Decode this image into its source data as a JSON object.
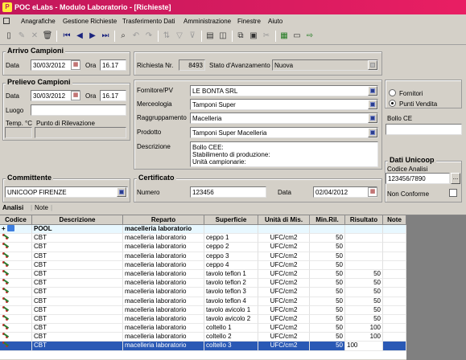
{
  "window": {
    "title": "POC eLabs - Modulo Laboratorio - [Richieste]",
    "logo": "P"
  },
  "menu": {
    "items": [
      "Anagrafiche",
      "Gestione Richieste",
      "Trasferimento Dati",
      "Amministrazione",
      "Finestre",
      "Aiuto"
    ]
  },
  "arrivo": {
    "title": "Arrivo Campioni",
    "data_label": "Data",
    "data_value": "30/03/2012",
    "ora_label": "Ora",
    "ora_value": "16.17"
  },
  "richiesta": {
    "nr_label": "Richiesta Nr.",
    "nr_value": "8493",
    "stato_label": "Stato d'Avanzamento",
    "stato_value": "Nuova"
  },
  "prelievo": {
    "title": "Prelievo Campioni",
    "data_label": "Data",
    "data_value": "30/03/2012",
    "ora_label": "Ora",
    "ora_value": "16.17",
    "luogo_label": "Luogo",
    "luogo_value": "",
    "temp_label": "Temp. °C",
    "punto_label": "Punto di Rilevazione"
  },
  "fornitore": {
    "label": "Fornitore/PV",
    "value": "LE BONTA  SRL"
  },
  "merceologia": {
    "label": "Merceologia",
    "value": "Tamponi Super"
  },
  "raggruppamento": {
    "label": "Raggruppamento",
    "value": "Macelleria"
  },
  "prodotto": {
    "label": "Prodotto",
    "value": "Tamponi Super Macelleria"
  },
  "descrizione": {
    "label": "Descrizione",
    "lines": [
      "Bollo CEE:",
      "Stabilimento di produzione:",
      "Unità campionarie:"
    ]
  },
  "radio": {
    "fornitori": "Fornitori",
    "punti_vendita": "Punti Vendita"
  },
  "bollo": {
    "label": "Bollo CE",
    "value": ""
  },
  "committente": {
    "title": "Committente",
    "value": "UNICOOP FIRENZE"
  },
  "certificato": {
    "title": "Certificato",
    "numero_label": "Numero",
    "numero_value": "123456",
    "data_label": "Data",
    "data_value": "02/04/2012"
  },
  "unicoop": {
    "title": "Dati Unicoop",
    "codice_label": "Codice Analisi",
    "codice_value": "123456/7890",
    "btn": "...",
    "nonconf_label": "Non Conforme"
  },
  "tabs": {
    "analisi": "Analisi",
    "note": "Note"
  },
  "grid": {
    "headers": [
      "Codice",
      "Descrizione",
      "Reparto",
      "Superficie",
      "Unità di Mis.",
      "Min.Ril.",
      "Risultato",
      "Note"
    ],
    "pool": {
      "plus": "+",
      "descr": "POOL",
      "reparto": "macelleria laboratorio"
    },
    "rows": [
      [
        "CBT",
        "macelleria laboratorio",
        "ceppo 1",
        "UFC/cm2",
        "50",
        ""
      ],
      [
        "CBT",
        "macelleria laboratorio",
        "ceppo 2",
        "UFC/cm2",
        "50",
        ""
      ],
      [
        "CBT",
        "macelleria laboratorio",
        "ceppo 3",
        "UFC/cm2",
        "50",
        ""
      ],
      [
        "CBT",
        "macelleria laboratorio",
        "ceppo 4",
        "UFC/cm2",
        "50",
        ""
      ],
      [
        "CBT",
        "macelleria laboratorio",
        "tavolo teflon 1",
        "UFC/cm2",
        "50",
        "50"
      ],
      [
        "CBT",
        "macelleria laboratorio",
        "tavolo teflon 2",
        "UFC/cm2",
        "50",
        "50"
      ],
      [
        "CBT",
        "macelleria laboratorio",
        "tavolo teflon 3",
        "UFC/cm2",
        "50",
        "50"
      ],
      [
        "CBT",
        "macelleria laboratorio",
        "tavolo teflon 4",
        "UFC/cm2",
        "50",
        "50"
      ],
      [
        "CBT",
        "macelleria laboratorio",
        "tavolo avicolo 1",
        "UFC/cm2",
        "50",
        "50"
      ],
      [
        "CBT",
        "macelleria laboratorio",
        "tavolo avicolo 2",
        "UFC/cm2",
        "50",
        "50"
      ],
      [
        "CBT",
        "macelleria laboratorio",
        "coltello 1",
        "UFC/cm2",
        "50",
        "100"
      ],
      [
        "CBT",
        "macelleria laboratorio",
        "coltello 2",
        "UFC/cm2",
        "50",
        "100"
      ],
      [
        "CBT",
        "macelleria laboratorio",
        "coltello 3",
        "UFC/cm2",
        "50",
        "100"
      ]
    ]
  }
}
